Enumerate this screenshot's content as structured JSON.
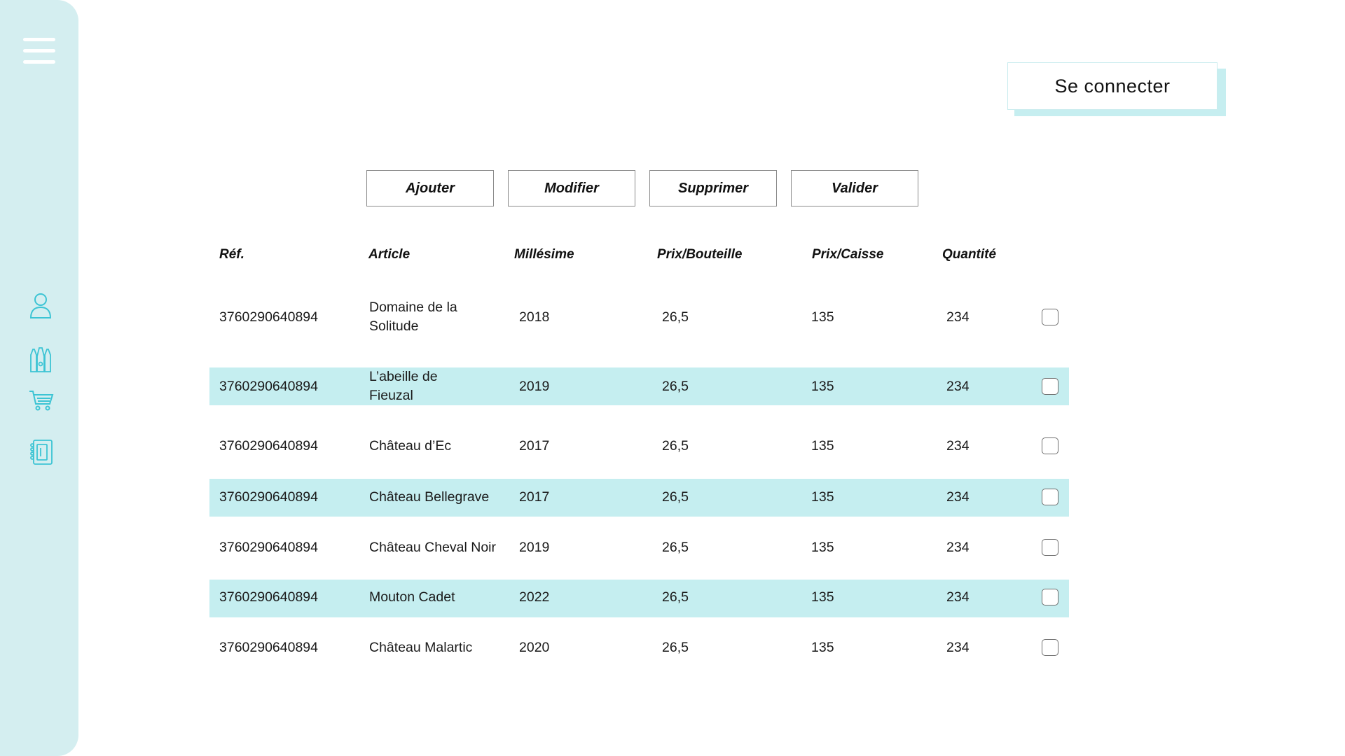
{
  "sidebar": {
    "menu_icon": "hamburger-menu-icon",
    "nav_icons": [
      "user-icon",
      "wine-bottles-icon",
      "shopping-cart-icon",
      "contact-book-icon"
    ],
    "bg_color": "#d4eef0",
    "icon_color": "#3cc4d4"
  },
  "header": {
    "connect_label": "Se connecter"
  },
  "toolbar": {
    "add_label": "Ajouter",
    "edit_label": "Modifier",
    "delete_label": "Supprimer",
    "validate_label": "Valider"
  },
  "table": {
    "headers": [
      "Réf.",
      "Article",
      "Millésime",
      "Prix/Bouteille",
      "Prix/Caisse",
      "Quantité"
    ],
    "highlight_color": "#c5eef0",
    "rows": [
      {
        "ref": "3760290640894",
        "article": "Domaine de la Solitude",
        "millesime": "2018",
        "prix_bouteille": "26,5",
        "prix_caisse": "135",
        "quantite": "234",
        "checked": false
      },
      {
        "ref": "3760290640894",
        "article": "L’abeille de Fieuzal",
        "millesime": "2019",
        "prix_bouteille": "26,5",
        "prix_caisse": "135",
        "quantite": "234",
        "checked": false
      },
      {
        "ref": "3760290640894",
        "article": "Château d’Ec",
        "millesime": "2017",
        "prix_bouteille": "26,5",
        "prix_caisse": "135",
        "quantite": "234",
        "checked": false
      },
      {
        "ref": "3760290640894",
        "article": "Château Bellegrave",
        "millesime": "2017",
        "prix_bouteille": "26,5",
        "prix_caisse": "135",
        "quantite": "234",
        "checked": false
      },
      {
        "ref": "3760290640894",
        "article": "Château Cheval Noir",
        "millesime": "2019",
        "prix_bouteille": "26,5",
        "prix_caisse": "135",
        "quantite": "234",
        "checked": false
      },
      {
        "ref": "3760290640894",
        "article": "Mouton Cadet",
        "millesime": "2022",
        "prix_bouteille": "26,5",
        "prix_caisse": "135",
        "quantite": "234",
        "checked": false
      },
      {
        "ref": "3760290640894",
        "article": "Château Malartic",
        "millesime": "2020",
        "prix_bouteille": "26,5",
        "prix_caisse": "135",
        "quantite": "234",
        "checked": false
      }
    ]
  }
}
